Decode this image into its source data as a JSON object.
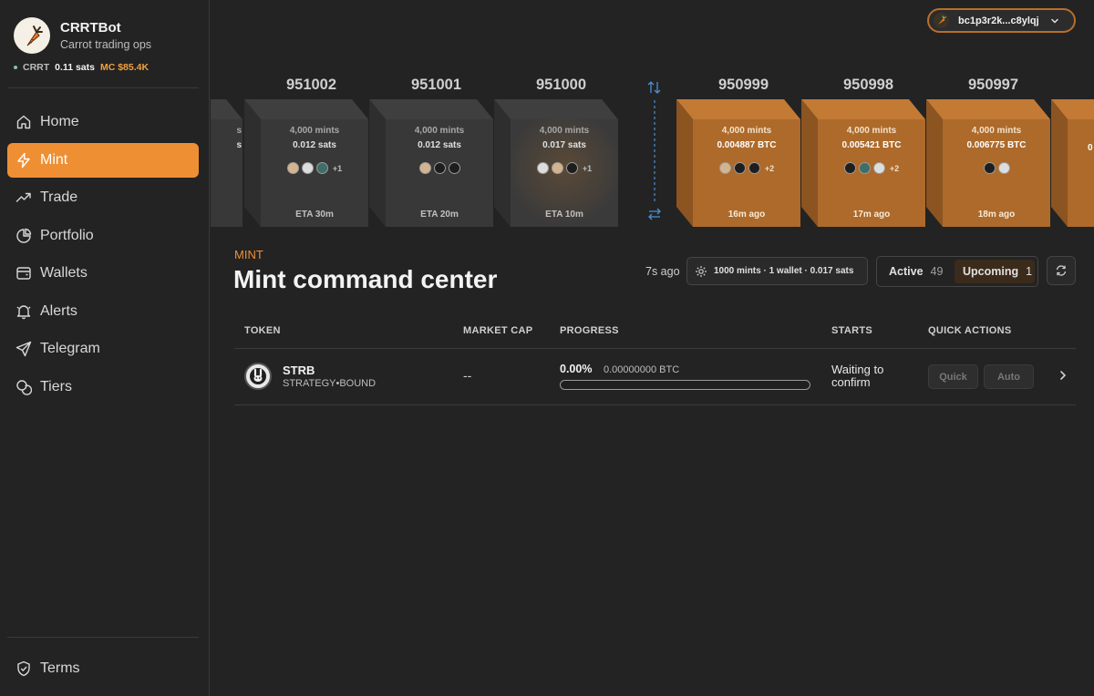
{
  "brand": {
    "name": "CRRTBot",
    "subtitle": "Carrot trading ops"
  },
  "ticker": {
    "symbol": "CRRT",
    "value": "0.11 sats",
    "market_cap": "MC $85.4K"
  },
  "nav": {
    "items": [
      {
        "label": "Home",
        "icon": "home-icon"
      },
      {
        "label": "Mint",
        "icon": "bolt-icon",
        "active": true
      },
      {
        "label": "Trade",
        "icon": "trend-icon"
      },
      {
        "label": "Portfolio",
        "icon": "pie-icon"
      },
      {
        "label": "Wallets",
        "icon": "wallet-icon"
      },
      {
        "label": "Alerts",
        "icon": "bell-icon"
      },
      {
        "label": "Telegram",
        "icon": "send-icon"
      },
      {
        "label": "Tiers",
        "icon": "coins-icon"
      }
    ],
    "terms": "Terms"
  },
  "wallet": {
    "address": "bc1p3r2k...c8ylqj"
  },
  "blocks": {
    "upcoming": [
      {
        "height": "951002",
        "line1": "4,000 mints",
        "line2": "0.012 sats",
        "more": "+1",
        "footer": "ETA 30m"
      },
      {
        "height": "951001",
        "line1": "4,000 mints",
        "line2": "0.012 sats",
        "more": "",
        "footer": "ETA 20m"
      },
      {
        "height": "951000",
        "line1": "4,000 mints",
        "line2": "0.017 sats",
        "more": "+1",
        "footer": "ETA 10m"
      }
    ],
    "mined": [
      {
        "height": "950999",
        "line1": "4,000 mints",
        "line2": "0.004887 BTC",
        "more": "+2",
        "footer": "16m ago"
      },
      {
        "height": "950998",
        "line1": "4,000 mints",
        "line2": "0.005421 BTC",
        "more": "+2",
        "footer": "17m ago"
      },
      {
        "height": "950997",
        "line1": "4,000 mints",
        "line2": "0.006775 BTC",
        "more": "",
        "footer": "18m ago"
      }
    ],
    "partial_left": {
      "line1": "s",
      "line2": "s"
    },
    "partial_right": {
      "height": "9",
      "line2": "0"
    }
  },
  "section": {
    "label": "MINT",
    "title": "Mint command center",
    "updated": "7s ago",
    "config": "1000 mints · 1 wallet · 0.017 sats",
    "tabs": [
      {
        "label": "Active",
        "count": "49"
      },
      {
        "label": "Upcoming",
        "count": "1",
        "selected": true
      }
    ]
  },
  "table": {
    "headers": [
      "TOKEN",
      "MARKET CAP",
      "PROGRESS",
      "STARTS",
      "QUICK ACTIONS"
    ],
    "rows": [
      {
        "symbol": "STRB",
        "name": "STRATEGY•BOUND",
        "market_cap": "--",
        "progress_pct": "0.00%",
        "progress_fraction": 0,
        "progress_btc": "0.00000000 BTC",
        "starts": "Waiting to confirm",
        "quick_label": "Quick",
        "auto_label": "Auto"
      }
    ]
  },
  "colors": {
    "accent": "#ef8f33",
    "mined_block": "#b06a2a",
    "upcoming_block": "#3a3a3a"
  }
}
